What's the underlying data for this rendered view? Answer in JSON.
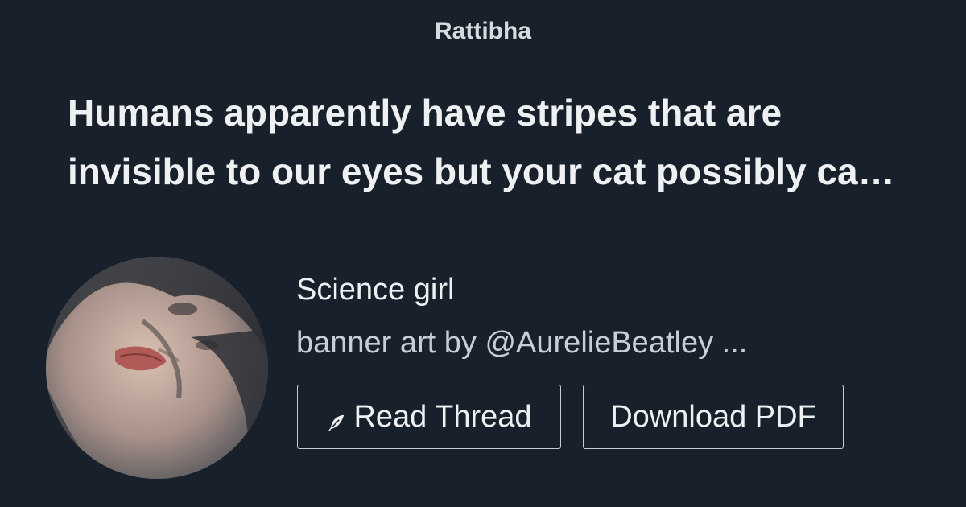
{
  "brand": "Rattibha",
  "thread": {
    "title": "Humans apparently have stripes that are invisible to our eyes but your cat possibly ca…"
  },
  "author": {
    "name": "Science girl",
    "bio": "banner art by @AurelieBeatley ..."
  },
  "actions": {
    "read_label": "Read Thread",
    "read_icon": "feather-icon",
    "pdf_label": "Download PDF"
  },
  "colors": {
    "background": "#18202b",
    "text": "#eef0f2",
    "button_border": "#c7ccd2"
  }
}
